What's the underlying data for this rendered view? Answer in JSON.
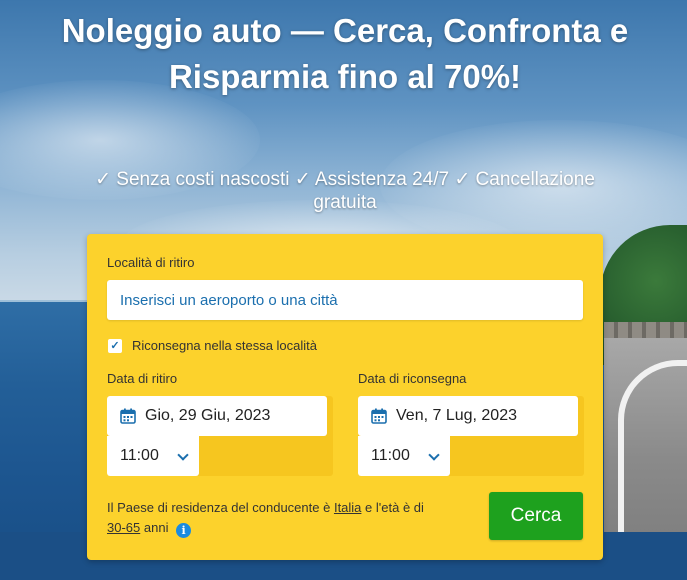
{
  "hero": {
    "title": "Noleggio auto — Cerca, Confronta e Risparmia fino al 70%!",
    "subtitle": "✓ Senza costi nascosti ✓ Assistenza 24/7 ✓ Cancellazione gratuita"
  },
  "form": {
    "pickup_location_label": "Località di ritiro",
    "pickup_location_placeholder": "Inserisci un aeroporto o una città",
    "same_location_checked": true,
    "same_location_label": "Riconsegna nella stessa località",
    "pickup_date_label": "Data di ritiro",
    "pickup_date_value": "Gio, 29 Giu, 2023",
    "pickup_time_value": "11:00",
    "return_date_label": "Data di riconsegna",
    "return_date_value": "Ven, 7 Lug, 2023",
    "return_time_value": "11:00",
    "residence_text_1": "Il Paese di residenza del conducente è",
    "residence_country": "Italia",
    "residence_text_2": "e l'età è di",
    "age_range": "30-65",
    "age_text": "anni",
    "info_icon_glyph": "i",
    "search_label": "Cerca"
  },
  "icons": {
    "calendar": "calendar-icon",
    "chevron": "chevron-down-icon",
    "check": "✓",
    "info": "info-icon"
  },
  "colors": {
    "card": "#fcd22c",
    "accent_blue": "#1b6fae",
    "search_green": "#1ea11e"
  }
}
